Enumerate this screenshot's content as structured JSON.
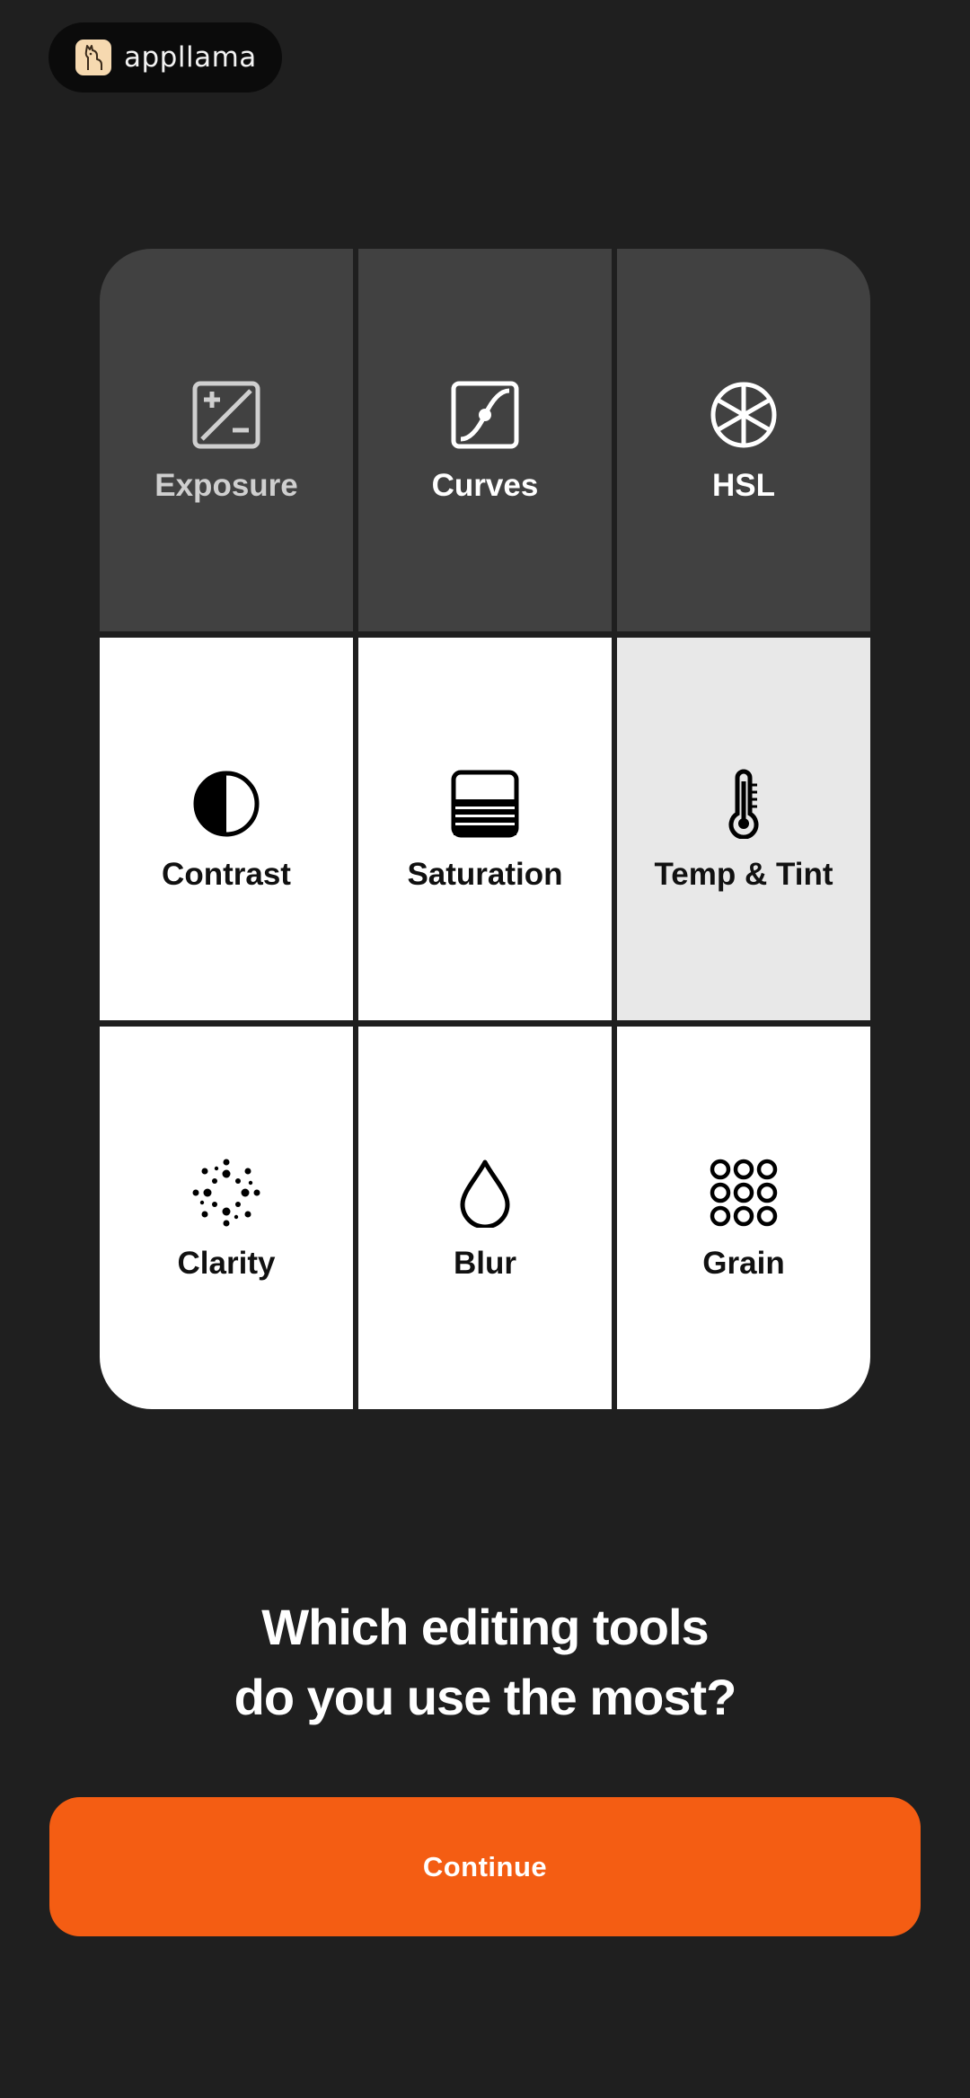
{
  "header": {
    "brand": "appllama"
  },
  "tools": [
    {
      "label": "Exposure",
      "icon": "exposure-icon",
      "selected": true
    },
    {
      "label": "Curves",
      "icon": "curves-icon",
      "selected": true
    },
    {
      "label": "HSL",
      "icon": "hsl-icon",
      "selected": true
    },
    {
      "label": "Contrast",
      "icon": "contrast-icon",
      "selected": false
    },
    {
      "label": "Saturation",
      "icon": "saturation-icon",
      "selected": false
    },
    {
      "label": "Temp & Tint",
      "icon": "thermometer-icon",
      "selected": false
    },
    {
      "label": "Clarity",
      "icon": "clarity-icon",
      "selected": false
    },
    {
      "label": "Blur",
      "icon": "droplet-icon",
      "selected": false
    },
    {
      "label": "Grain",
      "icon": "grain-icon",
      "selected": false
    }
  ],
  "question": {
    "line1": "Which editing tools",
    "line2": "do you use the most?"
  },
  "continue_label": "Continue",
  "colors": {
    "background": "#1f1f1f",
    "selected_tile": "#414141",
    "accent": "#f45d13"
  }
}
